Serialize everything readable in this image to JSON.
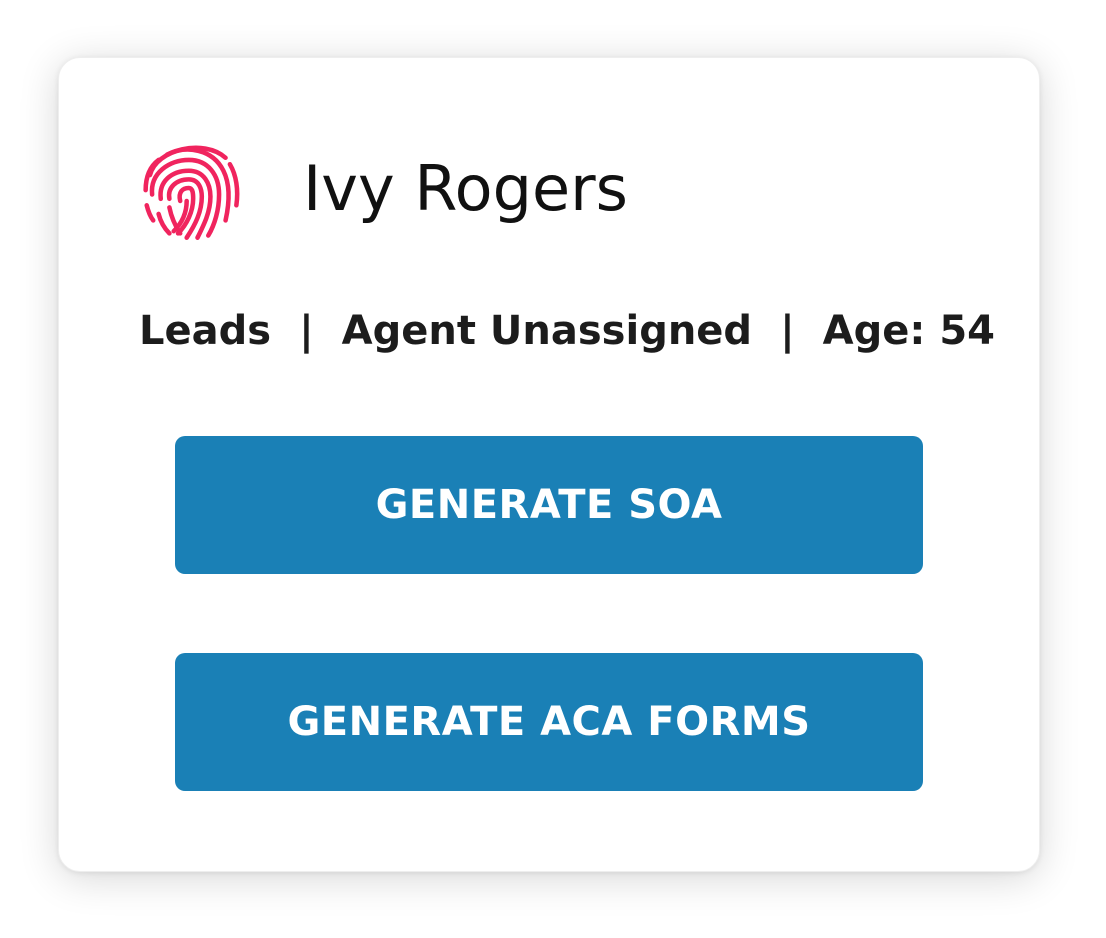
{
  "contact": {
    "name": "Ivy Rogers",
    "icon": "fingerprint-icon",
    "icon_color": "#f0245e"
  },
  "meta": {
    "stage": "Leads",
    "separator": "|",
    "agent": "Agent Unassigned",
    "age": "Age: 54"
  },
  "actions": {
    "generate_soa_label": "GENERATE SOA",
    "generate_aca_label": "GENERATE ACA FORMS",
    "button_color": "#1a80b6"
  }
}
